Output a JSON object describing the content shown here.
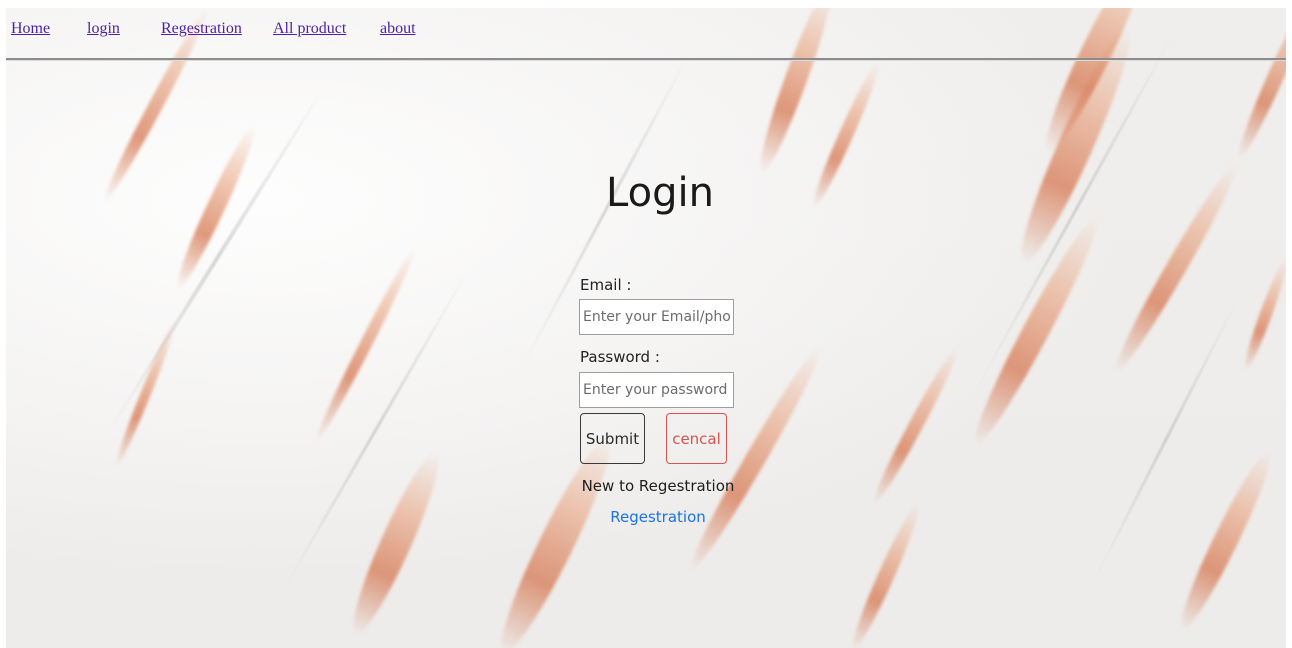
{
  "nav": {
    "links": [
      {
        "label": "Home"
      },
      {
        "label": "login"
      },
      {
        "label": "Regestration "
      },
      {
        "label": "All product "
      },
      {
        "label": "about"
      }
    ]
  },
  "login": {
    "title": "Login",
    "email_label": "Email :",
    "email_placeholder": "Enter your Email/phone",
    "email_value": "",
    "password_label": "Password :",
    "password_placeholder": "Enter your password",
    "password_value": "",
    "submit_label": "Submit",
    "cancel_label": "cencal",
    "new_to_text": "New to Regestration",
    "register_link": "Regestration"
  },
  "colors": {
    "nav_link": "#4b1fa6",
    "register_link": "#1a73e8",
    "cancel_accent": "#d9534f",
    "vein_copper": "#d67852"
  }
}
